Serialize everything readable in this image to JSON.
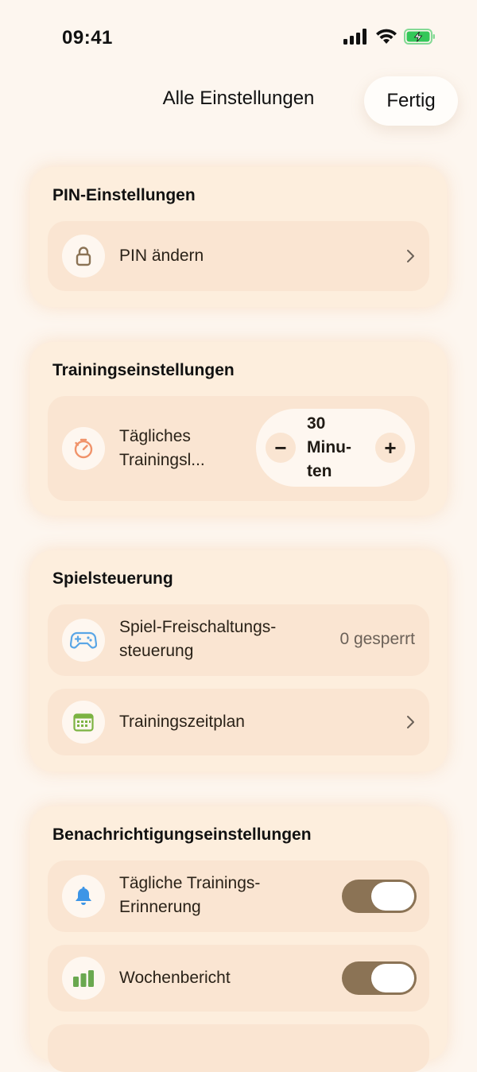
{
  "status_bar": {
    "time": "09:41",
    "icons": [
      "cellular-signal-icon",
      "wifi-icon",
      "battery-charging-icon"
    ],
    "battery_color": "#34c759"
  },
  "nav": {
    "title": "Alle Einstellungen",
    "done_label": "Fertig"
  },
  "sections": {
    "pin": {
      "title": "PIN-Einstellungen",
      "change_pin": {
        "label": "PIN ändern",
        "icon": "lock-icon"
      }
    },
    "training": {
      "title": "Trainingseinstellungen",
      "daily_limit": {
        "label_line1": "Tägliches",
        "label_line2": "Trainingsl...",
        "icon": "timer-icon",
        "minus": "−",
        "plus": "+",
        "value_line1": "30",
        "value_line2": "Minu-",
        "value_line3": "ten"
      }
    },
    "game": {
      "title": "Spielsteuerung",
      "unlock_control": {
        "label_line1": "Spiel-Freischaltungs-",
        "label_line2": "steuerung",
        "value": "0 gesperrt",
        "icon": "gamepad-icon"
      },
      "schedule": {
        "label": "Trainingszeitplan",
        "icon": "calendar-icon"
      }
    },
    "notifications": {
      "title": "Benachrichtigungseinstellungen",
      "daily_reminder": {
        "label_line1": "Tägliche Trainings-",
        "label_line2": "Erinnerung",
        "icon": "bell-icon",
        "on": true
      },
      "weekly_report": {
        "label": "Wochenbericht",
        "icon": "bar-chart-icon",
        "on": true
      }
    }
  },
  "colors": {
    "background": "#fdf6ef",
    "card": "#fdeedd",
    "row": "#fae5d2",
    "toggle_on": "#8b7355",
    "timer_icon": "#f0936a",
    "gamepad_icon": "#5aa6e6",
    "calendar_icon": "#7cb342",
    "bell_icon": "#3d95e6",
    "chart_icon": "#6aa84f",
    "lock_icon": "#8b7355"
  }
}
